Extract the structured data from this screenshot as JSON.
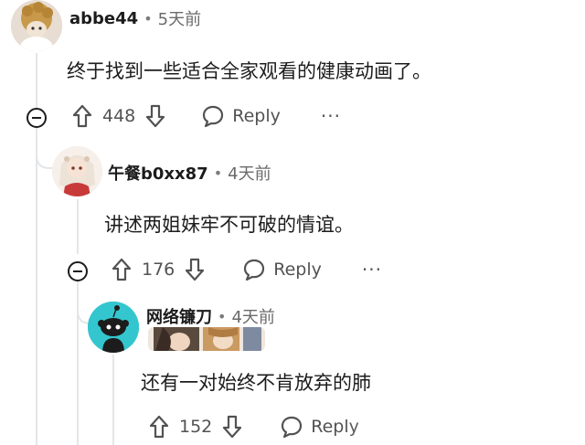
{
  "comments": [
    {
      "username": "abbe44",
      "separator": "•",
      "time": "5天前",
      "text": "终于找到一些适合全家观看的健康动画了。",
      "score": "448",
      "reply_label": "Reply",
      "more_label": "···"
    },
    {
      "username": "午餐b0xx87",
      "separator": "•",
      "time": "4天前",
      "text": "讲述两姐妹牢不可破的情谊。",
      "score": "176",
      "reply_label": "Reply",
      "more_label": "···"
    },
    {
      "username": "网络镰刀",
      "separator": "•",
      "time": "4天前",
      "text": "还有一对始终不肯放弃的肺",
      "score": "152",
      "reply_label": "Reply"
    }
  ],
  "icons": {
    "collapse": "collapse-icon",
    "upvote": "upvote-icon",
    "downvote": "downvote-icon",
    "reply": "reply-icon",
    "more": "more-icon"
  },
  "colors": {
    "text": "#1c1c1c",
    "meta": "#6a6a6a",
    "line": "#e4e6e8",
    "snoo_bg": "#34c6cf"
  }
}
